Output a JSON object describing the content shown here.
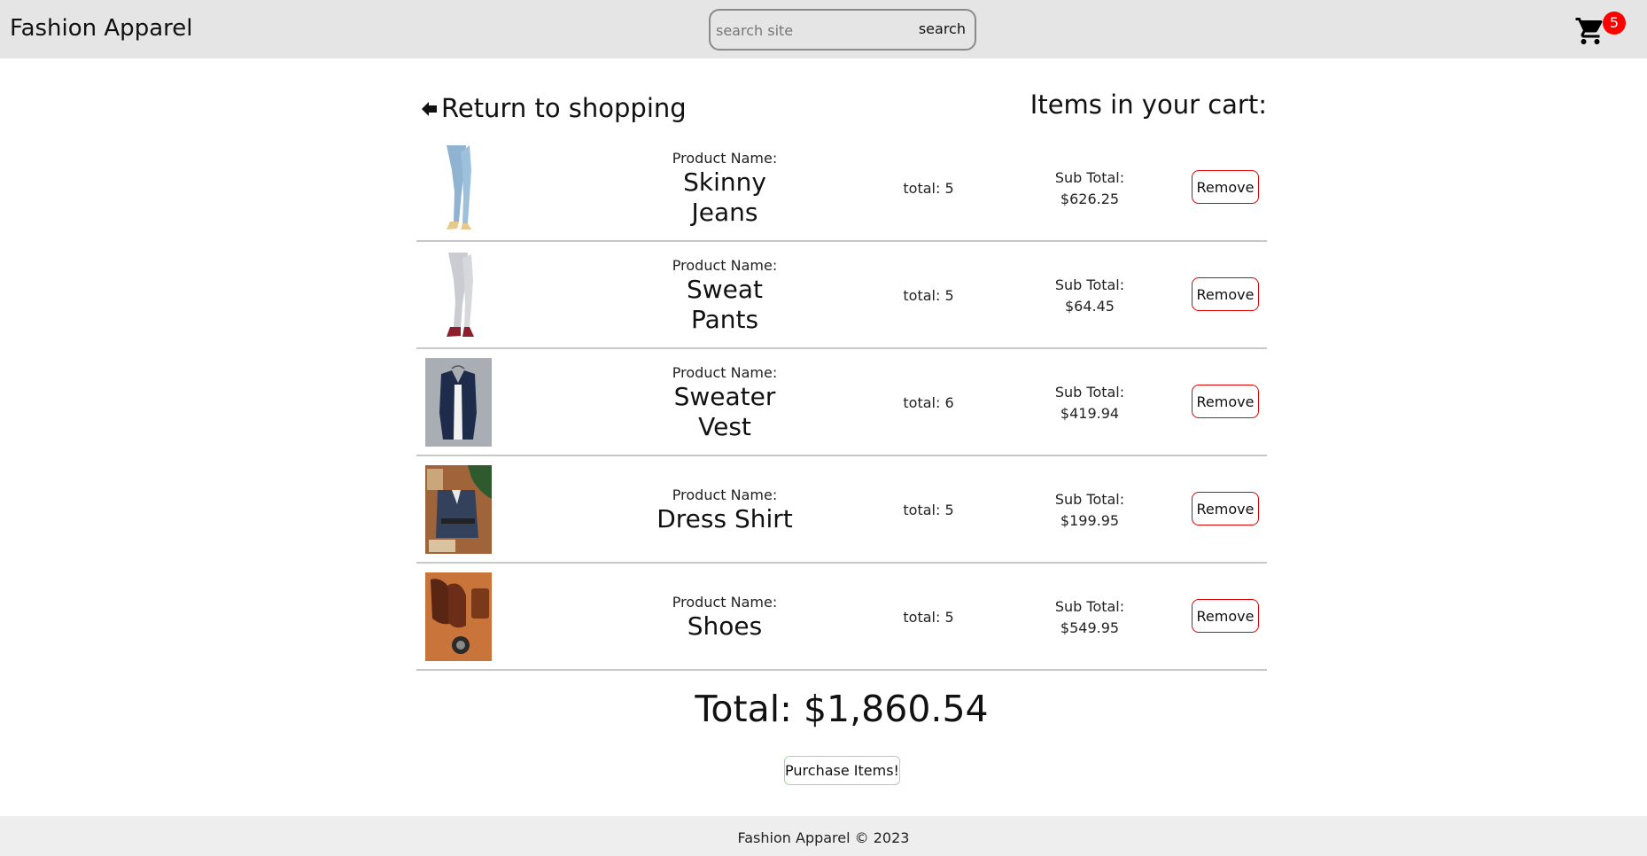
{
  "header": {
    "brand": "Fashion Apparel",
    "search": {
      "placeholder": "search site",
      "value": "",
      "button_label": "search"
    },
    "cart": {
      "icon": "cart-icon",
      "count": "5",
      "badge_color": "#ff0000"
    }
  },
  "cart_page": {
    "return_label": "Return to shopping",
    "return_icon": "arrow-left-icon",
    "heading": "Items in your cart:",
    "items": [
      {
        "label": "Product Name:",
        "name": "Skinny Jeans",
        "quantity": "total: 5",
        "subtotal_label": "Sub Total:",
        "subtotal": "$626.25",
        "remove_label": "Remove",
        "image": "skinny-jeans-image"
      },
      {
        "label": "Product Name:",
        "name": "Sweat Pants",
        "quantity": "total: 5",
        "subtotal_label": "Sub Total:",
        "subtotal": "$64.45",
        "remove_label": "Remove",
        "image": "sweat-pants-image"
      },
      {
        "label": "Product Name:",
        "name": "Sweater Vest",
        "quantity": "total: 6",
        "subtotal_label": "Sub Total:",
        "subtotal": "$419.94",
        "remove_label": "Remove",
        "image": "sweater-vest-image"
      },
      {
        "label": "Product Name:",
        "name": "Dress Shirt",
        "quantity": "total: 5",
        "subtotal_label": "Sub Total:",
        "subtotal": "$199.95",
        "remove_label": "Remove",
        "image": "dress-shirt-image"
      },
      {
        "label": "Product Name:",
        "name": "Shoes",
        "quantity": "total: 5",
        "subtotal_label": "Sub Total:",
        "subtotal": "$549.95",
        "remove_label": "Remove",
        "image": "shoes-image"
      }
    ],
    "total": "Total: $1,860.54",
    "purchase_label": "Purchase Items!"
  },
  "footer": {
    "text": "Fashion Apparel © 2023"
  },
  "colors": {
    "header_bg": "#e5e5e5",
    "remove_border": "#e00000",
    "purchase_border": "#a8d5a2"
  }
}
